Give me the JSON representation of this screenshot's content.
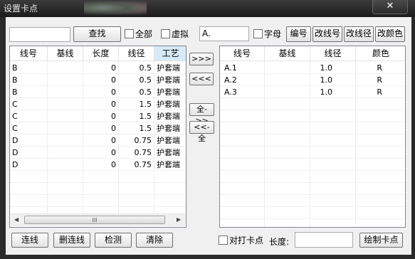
{
  "window": {
    "title": "设置卡点",
    "close_label": "✕"
  },
  "search": {
    "value": "",
    "button": "查找",
    "all_label": "全部",
    "virtual_label": "虚拟"
  },
  "filter": {
    "value": "A.",
    "letter_label": "字母",
    "btn_number": "编号",
    "btn_change_wire_no": "改线号",
    "btn_change_diameter": "改线径",
    "btn_change_color": "改颜色"
  },
  "left_table": {
    "headers": [
      "线号",
      "基线",
      "长度",
      "线径",
      "工艺"
    ],
    "rows": [
      [
        "B",
        "",
        "0",
        "0.5",
        "护套端"
      ],
      [
        "B",
        "",
        "0",
        "0.5",
        "护套端"
      ],
      [
        "B",
        "",
        "0",
        "0.5",
        "护套端"
      ],
      [
        "C",
        "",
        "0",
        "1.5",
        "护套端"
      ],
      [
        "C",
        "",
        "0",
        "1.5",
        "护套端"
      ],
      [
        "C",
        "",
        "0",
        "1.5",
        "护套端"
      ],
      [
        "D",
        "",
        "0",
        "0.75",
        "护套端"
      ],
      [
        "D",
        "",
        "0",
        "0.75",
        "护套端"
      ],
      [
        "D",
        "",
        "0",
        "0.75",
        "护套端"
      ]
    ],
    "scroll_thumb": "III"
  },
  "transfer": {
    "add": ">>>",
    "remove": "<<<",
    "add_all": "全->>",
    "remove_all": "<<-全"
  },
  "right_table": {
    "headers": [
      "线号",
      "基线",
      "线径",
      "颜色"
    ],
    "rows": [
      [
        "A.1",
        "",
        "1.0",
        "R"
      ],
      [
        "A.2",
        "",
        "1.0",
        "R"
      ],
      [
        "A.3",
        "",
        "1.0",
        "R"
      ]
    ]
  },
  "bottom": {
    "connect": "连线",
    "delete_connect": "删连线",
    "detect": "检测",
    "clear": "清除",
    "pair_label": "对打卡点",
    "length_label": "长度:",
    "length_value": "",
    "draw": "绘制卡点"
  }
}
